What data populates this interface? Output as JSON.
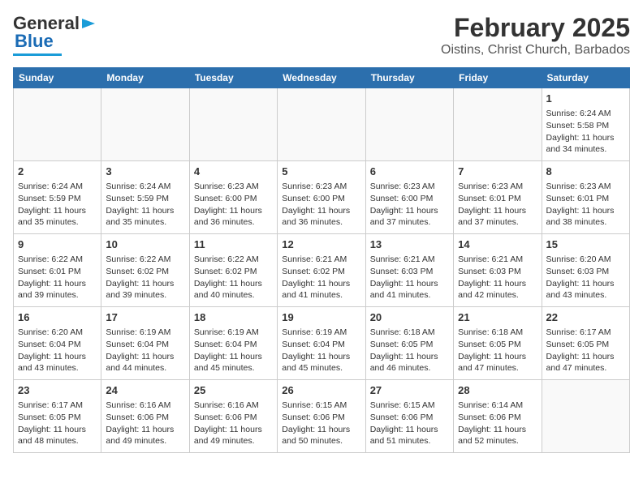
{
  "header": {
    "logo_line1": "General",
    "logo_line2": "Blue",
    "title": "February 2025",
    "subtitle": "Oistins, Christ Church, Barbados"
  },
  "weekdays": [
    "Sunday",
    "Monday",
    "Tuesday",
    "Wednesday",
    "Thursday",
    "Friday",
    "Saturday"
  ],
  "weeks": [
    [
      {
        "day": "",
        "info": ""
      },
      {
        "day": "",
        "info": ""
      },
      {
        "day": "",
        "info": ""
      },
      {
        "day": "",
        "info": ""
      },
      {
        "day": "",
        "info": ""
      },
      {
        "day": "",
        "info": ""
      },
      {
        "day": "1",
        "info": "Sunrise: 6:24 AM\nSunset: 5:58 PM\nDaylight: 11 hours and 34 minutes."
      }
    ],
    [
      {
        "day": "2",
        "info": "Sunrise: 6:24 AM\nSunset: 5:59 PM\nDaylight: 11 hours and 35 minutes."
      },
      {
        "day": "3",
        "info": "Sunrise: 6:24 AM\nSunset: 5:59 PM\nDaylight: 11 hours and 35 minutes."
      },
      {
        "day": "4",
        "info": "Sunrise: 6:23 AM\nSunset: 6:00 PM\nDaylight: 11 hours and 36 minutes."
      },
      {
        "day": "5",
        "info": "Sunrise: 6:23 AM\nSunset: 6:00 PM\nDaylight: 11 hours and 36 minutes."
      },
      {
        "day": "6",
        "info": "Sunrise: 6:23 AM\nSunset: 6:00 PM\nDaylight: 11 hours and 37 minutes."
      },
      {
        "day": "7",
        "info": "Sunrise: 6:23 AM\nSunset: 6:01 PM\nDaylight: 11 hours and 37 minutes."
      },
      {
        "day": "8",
        "info": "Sunrise: 6:23 AM\nSunset: 6:01 PM\nDaylight: 11 hours and 38 minutes."
      }
    ],
    [
      {
        "day": "9",
        "info": "Sunrise: 6:22 AM\nSunset: 6:01 PM\nDaylight: 11 hours and 39 minutes."
      },
      {
        "day": "10",
        "info": "Sunrise: 6:22 AM\nSunset: 6:02 PM\nDaylight: 11 hours and 39 minutes."
      },
      {
        "day": "11",
        "info": "Sunrise: 6:22 AM\nSunset: 6:02 PM\nDaylight: 11 hours and 40 minutes."
      },
      {
        "day": "12",
        "info": "Sunrise: 6:21 AM\nSunset: 6:02 PM\nDaylight: 11 hours and 41 minutes."
      },
      {
        "day": "13",
        "info": "Sunrise: 6:21 AM\nSunset: 6:03 PM\nDaylight: 11 hours and 41 minutes."
      },
      {
        "day": "14",
        "info": "Sunrise: 6:21 AM\nSunset: 6:03 PM\nDaylight: 11 hours and 42 minutes."
      },
      {
        "day": "15",
        "info": "Sunrise: 6:20 AM\nSunset: 6:03 PM\nDaylight: 11 hours and 43 minutes."
      }
    ],
    [
      {
        "day": "16",
        "info": "Sunrise: 6:20 AM\nSunset: 6:04 PM\nDaylight: 11 hours and 43 minutes."
      },
      {
        "day": "17",
        "info": "Sunrise: 6:19 AM\nSunset: 6:04 PM\nDaylight: 11 hours and 44 minutes."
      },
      {
        "day": "18",
        "info": "Sunrise: 6:19 AM\nSunset: 6:04 PM\nDaylight: 11 hours and 45 minutes."
      },
      {
        "day": "19",
        "info": "Sunrise: 6:19 AM\nSunset: 6:04 PM\nDaylight: 11 hours and 45 minutes."
      },
      {
        "day": "20",
        "info": "Sunrise: 6:18 AM\nSunset: 6:05 PM\nDaylight: 11 hours and 46 minutes."
      },
      {
        "day": "21",
        "info": "Sunrise: 6:18 AM\nSunset: 6:05 PM\nDaylight: 11 hours and 47 minutes."
      },
      {
        "day": "22",
        "info": "Sunrise: 6:17 AM\nSunset: 6:05 PM\nDaylight: 11 hours and 47 minutes."
      }
    ],
    [
      {
        "day": "23",
        "info": "Sunrise: 6:17 AM\nSunset: 6:05 PM\nDaylight: 11 hours and 48 minutes."
      },
      {
        "day": "24",
        "info": "Sunrise: 6:16 AM\nSunset: 6:06 PM\nDaylight: 11 hours and 49 minutes."
      },
      {
        "day": "25",
        "info": "Sunrise: 6:16 AM\nSunset: 6:06 PM\nDaylight: 11 hours and 49 minutes."
      },
      {
        "day": "26",
        "info": "Sunrise: 6:15 AM\nSunset: 6:06 PM\nDaylight: 11 hours and 50 minutes."
      },
      {
        "day": "27",
        "info": "Sunrise: 6:15 AM\nSunset: 6:06 PM\nDaylight: 11 hours and 51 minutes."
      },
      {
        "day": "28",
        "info": "Sunrise: 6:14 AM\nSunset: 6:06 PM\nDaylight: 11 hours and 52 minutes."
      },
      {
        "day": "",
        "info": ""
      }
    ]
  ]
}
